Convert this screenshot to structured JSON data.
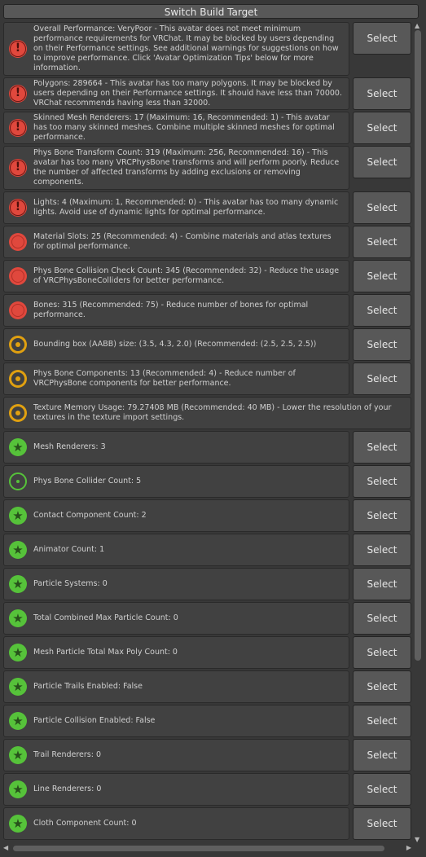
{
  "header": {
    "switch_build_target_label": "Switch Build Target"
  },
  "select_label": "Select",
  "rows": [
    {
      "level": "verypoor",
      "icon": "very-poor-icon",
      "h": 66,
      "select": true,
      "text": "Overall Performance: VeryPoor - This avatar does not meet minimum performance requirements for VRChat. It may be blocked by users depending on their Performance settings. See additional warnings for suggestions on how to improve performance. Click 'Avatar Optimization Tips' below for more information."
    },
    {
      "level": "verypoor",
      "icon": "very-poor-icon",
      "h": 40,
      "select": true,
      "text": "Polygons: 289664 - This avatar has too many polygons. It may be blocked by users depending on their Performance settings. It should have less than 70000. VRChat recommends having less than 32000."
    },
    {
      "level": "verypoor",
      "icon": "very-poor-icon",
      "h": 40,
      "select": true,
      "text": "Skinned Mesh Renderers: 17 (Maximum: 16, Recommended: 1) - This avatar has too many skinned meshes. Combine multiple skinned meshes for optimal performance."
    },
    {
      "level": "verypoor",
      "icon": "very-poor-icon",
      "h": 54,
      "select": true,
      "text": "Phys Bone Transform Count: 319 (Maximum: 256, Recommended: 16) - This avatar has too many VRCPhysBone transforms and will perform poorly. Reduce the number of affected transforms by adding exclusions or removing components."
    },
    {
      "level": "verypoor",
      "icon": "very-poor-icon",
      "h": 40,
      "select": true,
      "text": "Lights: 4 (Maximum: 1, Recommended: 0) - This avatar has too many dynamic lights. Avoid use of dynamic lights for optimal performance."
    },
    {
      "level": "poor",
      "icon": "poor-icon",
      "h": 40,
      "select": true,
      "text": "Material Slots: 25 (Recommended: 4) - Combine materials and atlas textures for optimal performance."
    },
    {
      "level": "poor",
      "icon": "poor-icon",
      "h": 40,
      "select": true,
      "text": "Phys Bone Collision Check Count: 345 (Recommended: 32) - Reduce the usage of VRCPhysBoneColliders for better performance."
    },
    {
      "level": "poor",
      "icon": "poor-icon",
      "h": 40,
      "select": true,
      "text": "Bones: 315 (Recommended: 75) - Reduce number of bones for optimal performance."
    },
    {
      "level": "medium",
      "icon": "medium-icon",
      "h": 40,
      "select": true,
      "text": "Bounding box (AABB) size: (3.5, 4.3, 2.0) (Recommended: (2.5, 2.5, 2.5))"
    },
    {
      "level": "medium",
      "icon": "medium-icon",
      "h": 40,
      "select": true,
      "text": "Phys Bone Components: 13 (Recommended: 4) - Reduce number of VRCPhysBone components for better performance."
    },
    {
      "level": "medium",
      "icon": "medium-icon",
      "h": 40,
      "select": false,
      "text": "Texture Memory Usage: 79.27408 MB (Recommended: 40 MB) - Lower the resolution of your textures in the texture import settings."
    },
    {
      "level": "excellent",
      "icon": "excellent-star-icon",
      "h": 40,
      "select": true,
      "text": "Mesh Renderers: 3"
    },
    {
      "level": "good",
      "icon": "good-icon",
      "h": 40,
      "select": true,
      "text": "Phys Bone Collider Count: 5"
    },
    {
      "level": "excellent",
      "icon": "excellent-star-icon",
      "h": 40,
      "select": true,
      "text": "Contact Component Count: 2"
    },
    {
      "level": "excellent",
      "icon": "excellent-star-icon",
      "h": 40,
      "select": true,
      "text": "Animator Count: 1"
    },
    {
      "level": "excellent",
      "icon": "excellent-star-icon",
      "h": 40,
      "select": true,
      "text": "Particle Systems: 0"
    },
    {
      "level": "excellent",
      "icon": "excellent-star-icon",
      "h": 40,
      "select": true,
      "text": "Total Combined Max Particle Count: 0"
    },
    {
      "level": "excellent",
      "icon": "excellent-star-icon",
      "h": 40,
      "select": true,
      "text": "Mesh Particle Total Max Poly Count: 0"
    },
    {
      "level": "excellent",
      "icon": "excellent-star-icon",
      "h": 40,
      "select": true,
      "text": "Particle Trails Enabled: False"
    },
    {
      "level": "excellent",
      "icon": "excellent-star-icon",
      "h": 40,
      "select": true,
      "text": "Particle Collision Enabled: False"
    },
    {
      "level": "excellent",
      "icon": "excellent-star-icon",
      "h": 40,
      "select": true,
      "text": "Trail Renderers: 0"
    },
    {
      "level": "excellent",
      "icon": "excellent-star-icon",
      "h": 40,
      "select": true,
      "text": "Line Renderers: 0"
    },
    {
      "level": "excellent",
      "icon": "excellent-star-icon",
      "h": 40,
      "select": true,
      "text": "Cloth Component Count: 0"
    }
  ],
  "colors": {
    "very_poor": "#e0483d",
    "poor": "#e0483d",
    "medium": "#e0a010",
    "excellent": "#56c23a",
    "background": "#383838",
    "button": "#585858"
  }
}
